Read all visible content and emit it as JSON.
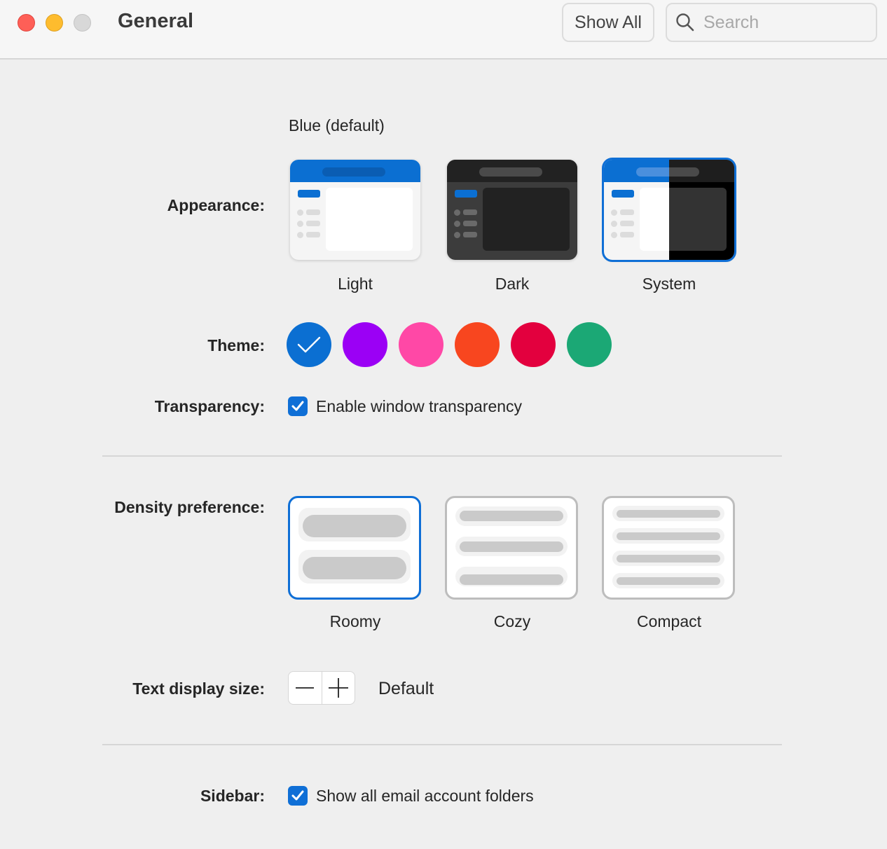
{
  "window": {
    "title": "General"
  },
  "toolbar": {
    "show_all_label": "Show All",
    "search_placeholder": "Search"
  },
  "appearance": {
    "label": "Appearance:",
    "accent_caption": "Blue (default)",
    "options": [
      {
        "label": "Light",
        "selected": false
      },
      {
        "label": "Dark",
        "selected": false
      },
      {
        "label": "System",
        "selected": true
      }
    ]
  },
  "theme": {
    "label": "Theme:",
    "swatches": [
      {
        "name": "blue",
        "color": "#0b6fd2",
        "selected": true
      },
      {
        "name": "purple",
        "color": "#9b00f5",
        "selected": false
      },
      {
        "name": "pink",
        "color": "#ff48a6",
        "selected": false
      },
      {
        "name": "orange",
        "color": "#f8461f",
        "selected": false
      },
      {
        "name": "red",
        "color": "#e3003e",
        "selected": false
      },
      {
        "name": "green",
        "color": "#1ba875",
        "selected": false
      }
    ]
  },
  "transparency": {
    "label": "Transparency:",
    "checkbox_label": "Enable window transparency",
    "checked": true
  },
  "density": {
    "label": "Density preference:",
    "options": [
      {
        "label": "Roomy",
        "selected": true
      },
      {
        "label": "Cozy",
        "selected": false
      },
      {
        "label": "Compact",
        "selected": false
      }
    ]
  },
  "text_size": {
    "label": "Text display size:",
    "value": "Default"
  },
  "sidebar": {
    "label": "Sidebar:",
    "checkbox_label": "Show all email account folders",
    "checked": true
  },
  "colors": {
    "accent": "#0f6fd6"
  }
}
